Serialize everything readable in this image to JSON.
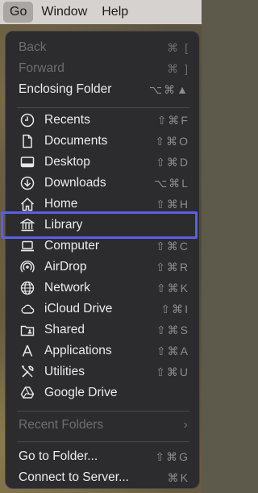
{
  "menubar": {
    "items": [
      "Go",
      "Window",
      "Help"
    ]
  },
  "menu": {
    "nav": [
      {
        "label": "Back",
        "shortcut": "⌘ [",
        "disabled": true
      },
      {
        "label": "Forward",
        "shortcut": "⌘ ]",
        "disabled": true
      },
      {
        "label": "Enclosing Folder",
        "shortcut": "⌥⌘▲",
        "disabled": false
      }
    ],
    "places": [
      {
        "label": "Recents",
        "shortcut": "⇧⌘F",
        "icon": "clock-icon"
      },
      {
        "label": "Documents",
        "shortcut": "⇧⌘O",
        "icon": "document-icon"
      },
      {
        "label": "Desktop",
        "shortcut": "⇧⌘D",
        "icon": "desktop-icon"
      },
      {
        "label": "Downloads",
        "shortcut": "⌥⌘L",
        "icon": "download-icon"
      },
      {
        "label": "Home",
        "shortcut": "⇧⌘H",
        "icon": "home-icon"
      },
      {
        "label": "Library",
        "shortcut": "",
        "icon": "library-icon"
      },
      {
        "label": "Computer",
        "shortcut": "⇧⌘C",
        "icon": "computer-icon"
      },
      {
        "label": "AirDrop",
        "shortcut": "⇧⌘R",
        "icon": "airdrop-icon"
      },
      {
        "label": "Network",
        "shortcut": "⇧⌘K",
        "icon": "network-icon"
      },
      {
        "label": "iCloud Drive",
        "shortcut": "⇧⌘I",
        "icon": "cloud-icon"
      },
      {
        "label": "Shared",
        "shortcut": "⇧⌘S",
        "icon": "shared-folder-icon"
      },
      {
        "label": "Applications",
        "shortcut": "⇧⌘A",
        "icon": "applications-icon"
      },
      {
        "label": "Utilities",
        "shortcut": "⇧⌘U",
        "icon": "utilities-icon"
      },
      {
        "label": "Google Drive",
        "shortcut": "",
        "icon": "google-drive-icon"
      }
    ],
    "recent_folders": {
      "label": "Recent Folders",
      "chevron": "›"
    },
    "footer": [
      {
        "label": "Go to Folder...",
        "shortcut": "⇧⌘G"
      },
      {
        "label": "Connect to Server...",
        "shortcut": "⌘K"
      }
    ]
  }
}
